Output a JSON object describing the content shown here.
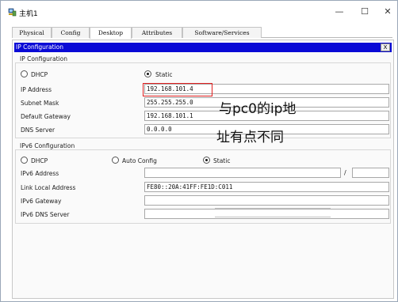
{
  "window": {
    "title": "主机1",
    "minimize": "—",
    "maximize": "☐",
    "close": "✕"
  },
  "tabs": [
    {
      "label": "Physical"
    },
    {
      "label": "Config"
    },
    {
      "label": "Desktop"
    },
    {
      "label": "Attributes"
    },
    {
      "label": "Software/Services"
    }
  ],
  "panel": {
    "title": "IP Configuration",
    "close_label": "X",
    "ipv4": {
      "group_title": "IP Configuration",
      "dhcp_label": "DHCP",
      "static_label": "Static",
      "selected": "Static",
      "fields": {
        "ip_address": {
          "label": "IP Address",
          "value": "192.168.101.4"
        },
        "subnet_mask": {
          "label": "Subnet Mask",
          "value": "255.255.255.0"
        },
        "default_gateway": {
          "label": "Default Gateway",
          "value": "192.168.101.1"
        },
        "dns_server": {
          "label": "DNS Server",
          "value": "0.0.0.0"
        }
      }
    },
    "ipv6": {
      "group_title": "IPv6 Configuration",
      "dhcp_label": "DHCP",
      "auto_label": "Auto Config",
      "static_label": "Static",
      "selected": "Static",
      "fields": {
        "ipv6_address": {
          "label": "IPv6 Address",
          "value": "",
          "prefix": ""
        },
        "link_local": {
          "label": "Link Local Address",
          "value": "FE80::20A:41FF:FE1D:C011"
        },
        "ipv6_gateway": {
          "label": "IPv6 Gateway",
          "value": ""
        },
        "ipv6_dns": {
          "label": "IPv6 DNS Server",
          "value": ""
        }
      },
      "prefix_separator": "/"
    }
  },
  "annotation": {
    "line1": "与pc0的ip地",
    "line2": "址有点不同",
    "color": "#e02020"
  }
}
